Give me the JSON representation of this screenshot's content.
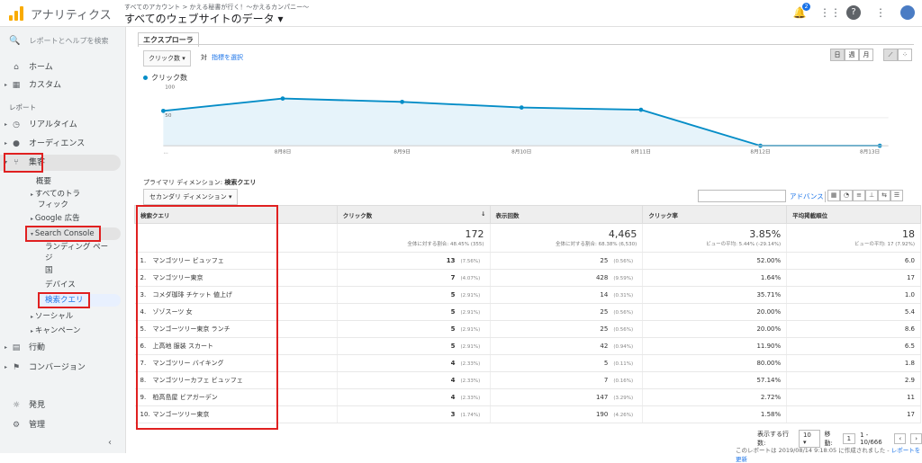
{
  "app": {
    "title": "アナリティクス",
    "account_path": "すべてのアカウント > かえる秘書が行く！～かえるカンパニー～",
    "view": "すべてのウェブサイトのデータ ▾",
    "notif_count": "2"
  },
  "sidebar": {
    "search_placeholder": "レポートとヘルプを検索",
    "home": "ホーム",
    "custom": "カスタム",
    "reports_header": "レポート",
    "realtime": "リアルタイム",
    "audience": "オーディエンス",
    "acquisition": "集客",
    "overview": "概要",
    "all_traffic_1": "すべてのトラ",
    "all_traffic_2": "フィック",
    "google_ads": "Google 広告",
    "search_console": "Search Console",
    "landing_1": "ランディング ペー",
    "landing_2": "ジ",
    "countries": "国",
    "devices": "デバイス",
    "queries": "検索クエリ",
    "social": "ソーシャル",
    "campaigns": "キャンペーン",
    "behavior": "行動",
    "conversions": "コンバージョン",
    "discover": "発見",
    "admin": "管理"
  },
  "explorer": {
    "tab": "エクスプローラ",
    "metric": "クリック数 ▾",
    "vs": "対",
    "select_metric": "指標を選択",
    "periods": [
      "日",
      "週",
      "月"
    ],
    "legend": "クリック数"
  },
  "chart_data": {
    "type": "area",
    "series": [
      {
        "name": "クリック数",
        "values": [
          62,
          84,
          78,
          68,
          64,
          0,
          0
        ]
      }
    ],
    "x": [
      "...",
      "8月8日",
      "8月9日",
      "8月10日",
      "8月11日",
      "8月12日",
      "8月13日"
    ],
    "y_ticks": [
      "100",
      "50"
    ],
    "ylim": [
      0,
      100
    ],
    "color": "#058dc7"
  },
  "table": {
    "primary_dim_label": "プライマリ ディメンション:",
    "primary_dim": "検索クエリ",
    "secondary_dim": "セカンダリ ディメンション ▾",
    "advanced": "アドバンス",
    "headers": [
      "検索クエリ",
      "クリック数",
      "表示回数",
      "クリック率",
      "平均掲載順位"
    ],
    "totals": {
      "clicks": "172",
      "clicks_sub": "全体に対する割合: 48.45% (355)",
      "impr": "4,465",
      "impr_sub": "全体に対する割合: 68.38% (6,530)",
      "ctr": "3.85%",
      "ctr_sub": "ビューの平均: 5.44% (-29.14%)",
      "pos": "18",
      "pos_sub": "ビューの平均: 17 (7.92%)"
    },
    "rows": [
      {
        "i": "1.",
        "q": "マンゴツリー ビュッフェ",
        "c": "13",
        "cp": "(7.56%)",
        "im": "25",
        "ip": "(0.56%)",
        "ctr": "52.00%",
        "pos": "6.0"
      },
      {
        "i": "2.",
        "q": "マンゴツリー東京",
        "c": "7",
        "cp": "(4.07%)",
        "im": "428",
        "ip": "(9.59%)",
        "ctr": "1.64%",
        "pos": "17"
      },
      {
        "i": "3.",
        "q": "コメダ珈琲 チケット 値上げ",
        "c": "5",
        "cp": "(2.91%)",
        "im": "14",
        "ip": "(0.31%)",
        "ctr": "35.71%",
        "pos": "1.0"
      },
      {
        "i": "4.",
        "q": "ゾゾスーツ 女",
        "c": "5",
        "cp": "(2.91%)",
        "im": "25",
        "ip": "(0.56%)",
        "ctr": "20.00%",
        "pos": "5.4"
      },
      {
        "i": "5.",
        "q": "マンゴーツリー東京 ランチ",
        "c": "5",
        "cp": "(2.91%)",
        "im": "25",
        "ip": "(0.56%)",
        "ctr": "20.00%",
        "pos": "8.6"
      },
      {
        "i": "6.",
        "q": "上高地 服装 スカート",
        "c": "5",
        "cp": "(2.91%)",
        "im": "42",
        "ip": "(0.94%)",
        "ctr": "11.90%",
        "pos": "6.5"
      },
      {
        "i": "7.",
        "q": "マンゴツリー バイキング",
        "c": "4",
        "cp": "(2.33%)",
        "im": "5",
        "ip": "(0.11%)",
        "ctr": "80.00%",
        "pos": "1.8"
      },
      {
        "i": "8.",
        "q": "マンゴツリーカフェ ビュッフェ",
        "c": "4",
        "cp": "(2.33%)",
        "im": "7",
        "ip": "(0.16%)",
        "ctr": "57.14%",
        "pos": "2.9"
      },
      {
        "i": "9.",
        "q": "柏高島屋 ビアガーデン",
        "c": "4",
        "cp": "(2.33%)",
        "im": "147",
        "ip": "(3.29%)",
        "ctr": "2.72%",
        "pos": "11"
      },
      {
        "i": "10.",
        "q": "マンゴーツリー東京",
        "c": "3",
        "cp": "(1.74%)",
        "im": "190",
        "ip": "(4.26%)",
        "ctr": "1.58%",
        "pos": "17"
      }
    ]
  },
  "pager": {
    "rows_label": "表示する行数:",
    "rows": "10",
    "goto_label": "移動:",
    "page": "1",
    "range": "1 - 10/666"
  },
  "footnote": {
    "text": "このレポートは 2019/08/14 9:18:05 に作成されました - ",
    "link": "レポートを更新"
  }
}
